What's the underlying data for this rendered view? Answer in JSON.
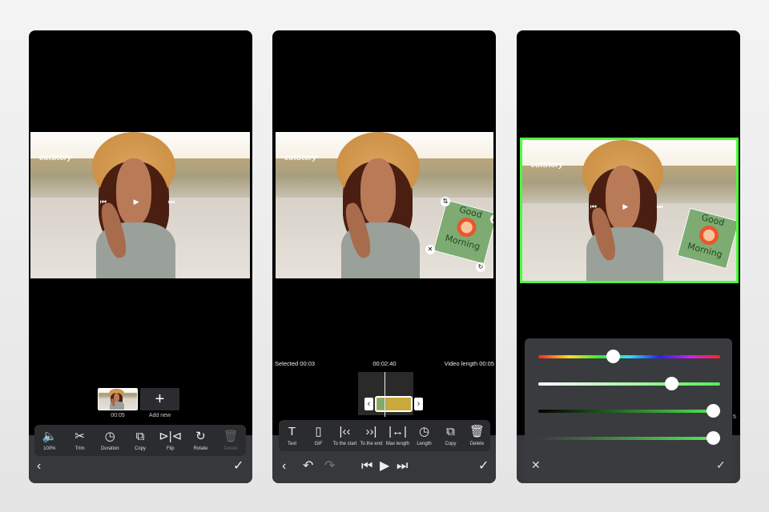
{
  "watermark": "cutStory",
  "panel1": {
    "thumb_time": "00:05",
    "add_new": "Add new",
    "add_icon": "+",
    "tools": [
      {
        "icon": "volume-icon",
        "glyph": "🔈",
        "label": "100%"
      },
      {
        "icon": "scissors-icon",
        "glyph": "✂",
        "label": "Trim"
      },
      {
        "icon": "clock-icon",
        "glyph": "◷",
        "label": "Duration"
      },
      {
        "icon": "copy-icon",
        "glyph": "⧉",
        "label": "Copy"
      },
      {
        "icon": "flip-icon",
        "glyph": "⊳|⊲",
        "label": "Flip"
      },
      {
        "icon": "rotate-icon",
        "glyph": "↻",
        "label": "Rotate"
      },
      {
        "icon": "trash-icon",
        "glyph": "🗑",
        "label": "Delete",
        "disabled": true
      }
    ]
  },
  "panel2": {
    "selected": "Selected 00:03",
    "current": "00:02:40",
    "length": "Video length 00:05",
    "sticker": {
      "line1": "Good",
      "line2": "Morning"
    },
    "tools": [
      {
        "icon": "text-icon",
        "glyph": "T",
        "label": "Text"
      },
      {
        "icon": "gif-icon",
        "glyph": "▯",
        "label": "GIF"
      },
      {
        "icon": "to-start-icon",
        "glyph": "|‹‹",
        "label": "To the start"
      },
      {
        "icon": "to-end-icon",
        "glyph": "››|",
        "label": "To the end"
      },
      {
        "icon": "max-length-icon",
        "glyph": "|↔|",
        "label": "Max length"
      },
      {
        "icon": "clock-icon",
        "glyph": "◷",
        "label": "Length"
      },
      {
        "icon": "copy-icon",
        "glyph": "⧉",
        "label": "Copy"
      },
      {
        "icon": "trash-icon",
        "glyph": "🗑",
        "label": "Delete"
      }
    ]
  },
  "panel3": {
    "sticker": {
      "line1": "Good",
      "line2": "Morning"
    },
    "partial_text": "5",
    "sliders": [
      {
        "name": "hue",
        "value": 0.41
      },
      {
        "name": "saturation",
        "value": 0.73
      },
      {
        "name": "brightness",
        "value": 0.96
      },
      {
        "name": "opacity",
        "value": 0.96
      }
    ]
  },
  "colors": {
    "accent": "#4cff3a",
    "toolbar": "#2b2c2f",
    "clip": "#c9a93b"
  }
}
